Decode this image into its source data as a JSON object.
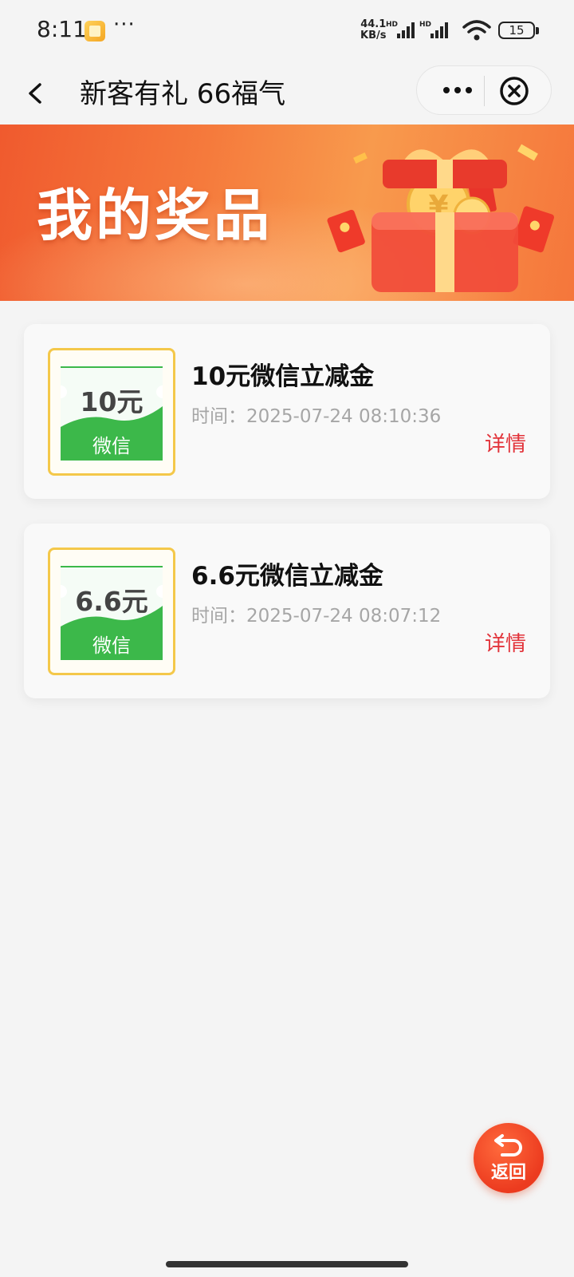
{
  "status_bar": {
    "time": "8:11",
    "more": "···",
    "speed_value": "44.1",
    "speed_unit": "KB/s",
    "signal_label": "HD",
    "battery": "15",
    "icons": [
      "app-notification-icon",
      "signal-icon",
      "wifi-icon",
      "battery-icon"
    ]
  },
  "nav": {
    "title": "新客有礼 66福气",
    "icons": [
      "back-icon",
      "more-icon",
      "close-icon"
    ]
  },
  "banner": {
    "title": "我的奖品"
  },
  "prizes": [
    {
      "coupon_amount": "10元",
      "coupon_brand": "微信",
      "name": "10元微信立减金",
      "time": "时间：2025-07-24 08:10:36",
      "detail_label": "详情"
    },
    {
      "coupon_amount": "6.6元",
      "coupon_brand": "微信",
      "name": "6.6元微信立减金",
      "time": "时间：2025-07-24 08:07:12",
      "detail_label": "详情"
    }
  ],
  "return_button": {
    "label": "返回"
  },
  "colors": {
    "accent_red": "#e2333a",
    "banner_orange": "#f57a3c",
    "coupon_green": "#3cb84a",
    "coupon_border": "#f4c84a"
  }
}
